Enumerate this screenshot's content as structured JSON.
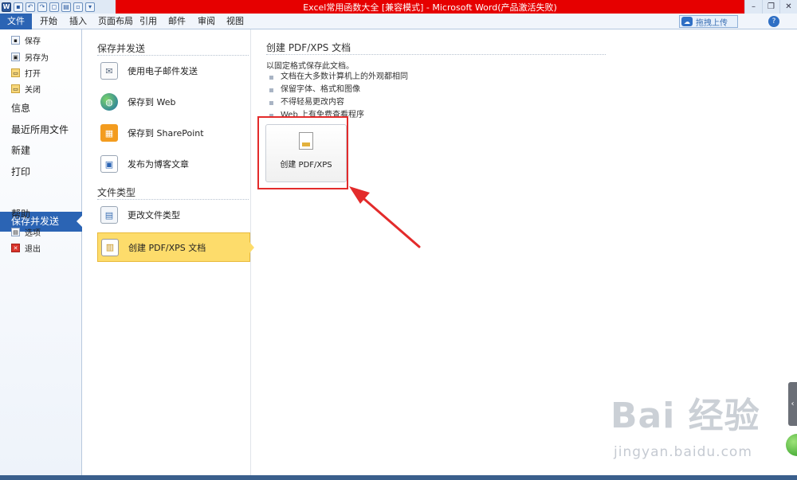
{
  "window": {
    "title": "Excel常用函数大全 [兼容模式] - Microsoft Word(产品激活失败)"
  },
  "ribbon": {
    "tabs": [
      "文件",
      "开始",
      "插入",
      "页面布局",
      "引用",
      "邮件",
      "审阅",
      "视图"
    ],
    "upload_label": "拖拽上传"
  },
  "leftnav": {
    "save": "保存",
    "save_as": "另存为",
    "open": "打开",
    "close": "关闭",
    "info": "信息",
    "recent": "最近所用文件",
    "new": "新建",
    "print": "打印",
    "save_send": "保存并发送",
    "help": "帮助",
    "options": "选项",
    "exit": "退出"
  },
  "middle": {
    "section_send": "保存并发送",
    "send_items": [
      "使用电子邮件发送",
      "保存到 Web",
      "保存到 SharePoint",
      "发布为博客文章"
    ],
    "section_filetype": "文件类型",
    "filetype_items": [
      "更改文件类型",
      "创建 PDF/XPS 文档"
    ]
  },
  "right": {
    "title": "创建 PDF/XPS 文档",
    "description": "以固定格式保存此文档。",
    "bullets": [
      "文档在大多数计算机上的外观都相同",
      "保留字体、格式和图像",
      "不得轻易更改内容",
      "Web 上有免费查看程序"
    ],
    "button_label": "创建 PDF/XPS"
  },
  "watermark": {
    "big": "Bai 经验",
    "small": "jingyan.baidu.com"
  },
  "colors": {
    "title_bar_red": "#e60000",
    "accent_blue": "#2b64b4",
    "selected_yellow": "#fddc6b",
    "highlight_red": "#e32b2b"
  }
}
